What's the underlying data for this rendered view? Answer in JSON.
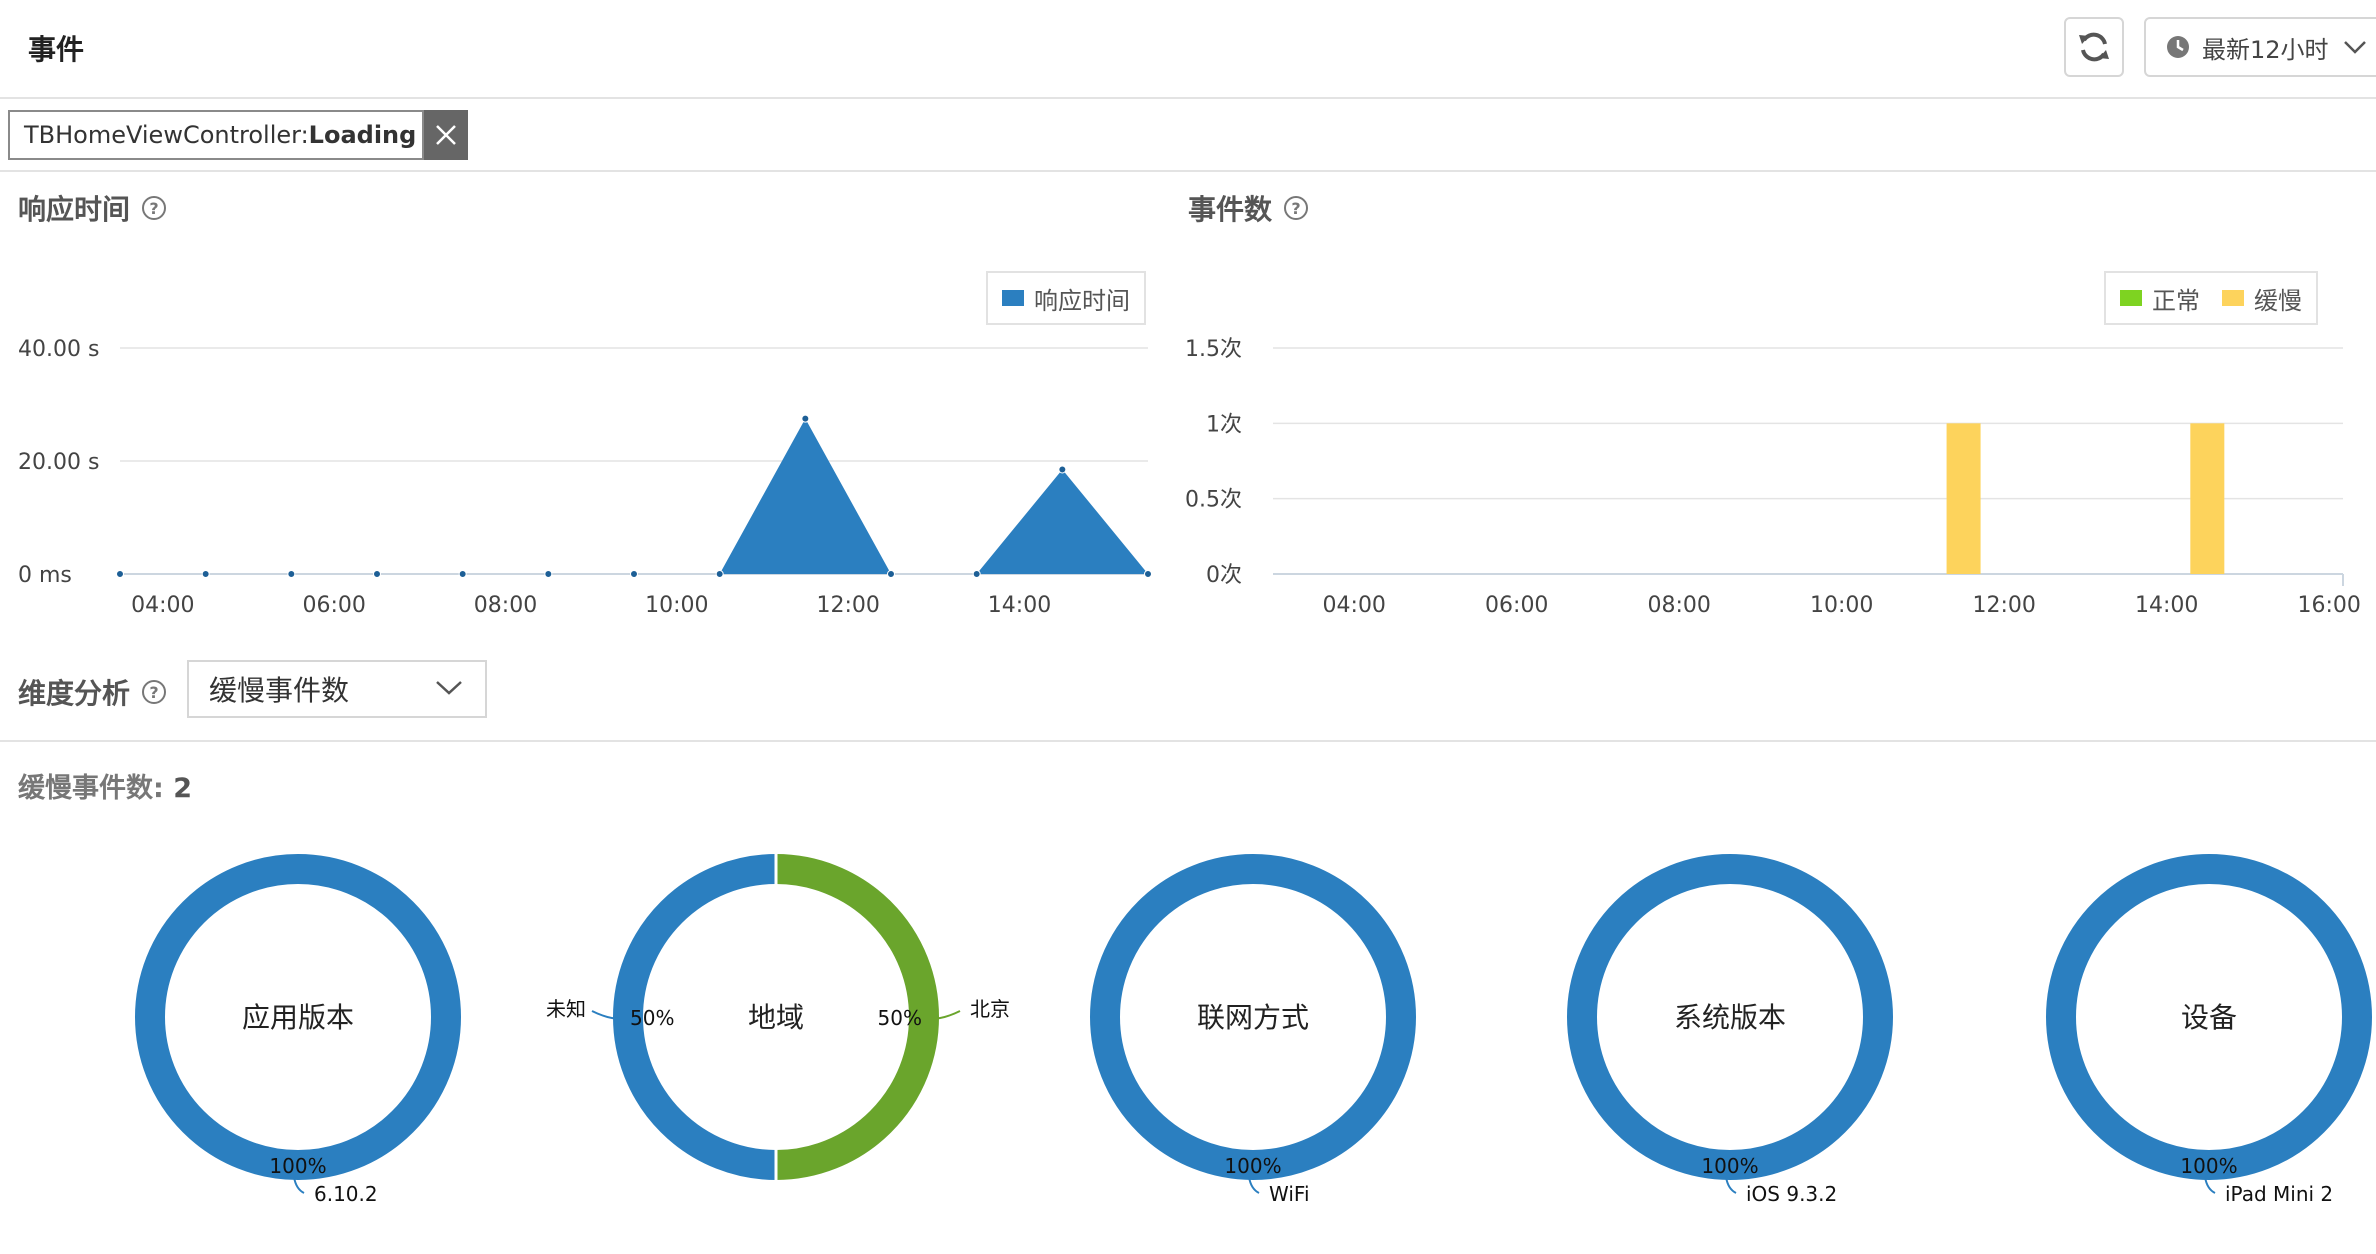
{
  "header": {
    "title": "事件",
    "time_range": "最新12小时"
  },
  "filter": {
    "tag_prefix": "TBHomeViewController: ",
    "tag_bold": "Loading ..."
  },
  "response_time": {
    "title": "响应时间",
    "legend": "响应时间"
  },
  "event_count": {
    "title": "事件数",
    "legend": [
      "正常",
      "缓慢"
    ]
  },
  "dimension": {
    "title": "维度分析",
    "selected": "缓慢事件数"
  },
  "slow_events": {
    "label": "缓慢事件数: ",
    "count": "2"
  },
  "colors": {
    "blue": "#2b7fc0",
    "green": "#6aa52c",
    "normal": "#7ed321",
    "slow": "#fdd35c"
  },
  "chart_data": [
    {
      "type": "area",
      "title": "响应时间",
      "x_ticks": [
        "04:00",
        "06:00",
        "08:00",
        "10:00",
        "12:00",
        "14:00"
      ],
      "y_ticks": [
        "0 ms",
        "20.00 s",
        "40.00 s"
      ],
      "ylim": [
        0,
        40
      ],
      "legend_position": "top-right",
      "series": [
        {
          "name": "响应时间",
          "x": [
            "03:30",
            "04:30",
            "05:30",
            "06:30",
            "07:30",
            "08:30",
            "09:30",
            "10:30",
            "11:30",
            "12:30",
            "13:30",
            "14:30",
            "15:30"
          ],
          "values": [
            0,
            0,
            0,
            0,
            0,
            0,
            0,
            0,
            27.5,
            0,
            0,
            18.5,
            0
          ]
        }
      ]
    },
    {
      "type": "bar",
      "title": "事件数",
      "x_ticks": [
        "04:00",
        "06:00",
        "08:00",
        "10:00",
        "12:00",
        "14:00",
        "16:00"
      ],
      "y_ticks": [
        "0次",
        "0.5次",
        "1次",
        "1.5次"
      ],
      "ylim": [
        0,
        1.5
      ],
      "legend_position": "top-right",
      "series": [
        {
          "name": "正常",
          "x": [],
          "values": []
        },
        {
          "name": "缓慢",
          "x": [
            "11:30",
            "14:30"
          ],
          "values": [
            1,
            1
          ]
        }
      ]
    },
    {
      "type": "pie",
      "charts": [
        {
          "center_label": "应用版本",
          "slices": [
            {
              "label": "6.10.2",
              "percent": "100%",
              "value": 100
            }
          ]
        },
        {
          "center_label": "地域",
          "slices": [
            {
              "label": "北京",
              "percent": "50%",
              "value": 50
            },
            {
              "label": "未知",
              "percent": "50%",
              "value": 50
            }
          ]
        },
        {
          "center_label": "联网方式",
          "slices": [
            {
              "label": "WiFi",
              "percent": "100%",
              "value": 100
            }
          ]
        },
        {
          "center_label": "系统版本",
          "slices": [
            {
              "label": "iOS 9.3.2",
              "percent": "100%",
              "value": 100
            }
          ]
        },
        {
          "center_label": "设备",
          "slices": [
            {
              "label": "iPad Mini 2",
              "percent": "100%",
              "value": 100
            }
          ]
        }
      ]
    }
  ]
}
